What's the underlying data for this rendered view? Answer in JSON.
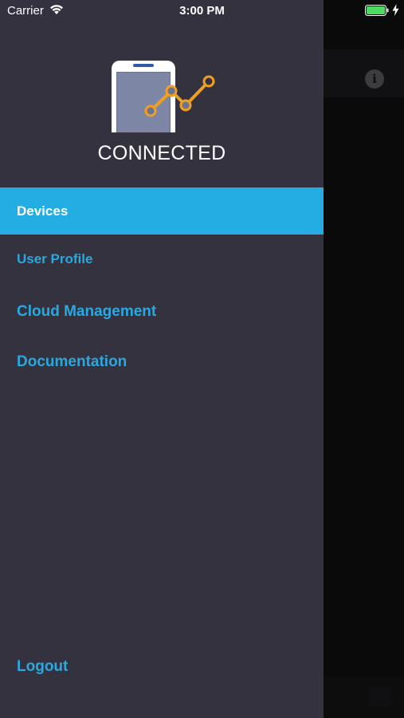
{
  "status_bar": {
    "carrier": "Carrier",
    "time": "3:00 PM",
    "wifi_icon": "wifi-icon",
    "battery_icon": "battery-icon",
    "battery_color": "#4cd964"
  },
  "drawer": {
    "brand": "CONNECTED",
    "logo_icon": "phone-chart-icon",
    "logo_accent": "#f0a020",
    "background": "#33323e",
    "active_color": "#23ade2",
    "link_color": "#2aa8e0",
    "menu": {
      "devices": "Devices",
      "user_profile": "User Profile",
      "cloud_management": "Cloud Management",
      "documentation": "Documentation",
      "logout": "Logout"
    },
    "active_item": "Devices"
  },
  "background_app": {
    "info_icon": "info-icon",
    "info_glyph": "i"
  }
}
